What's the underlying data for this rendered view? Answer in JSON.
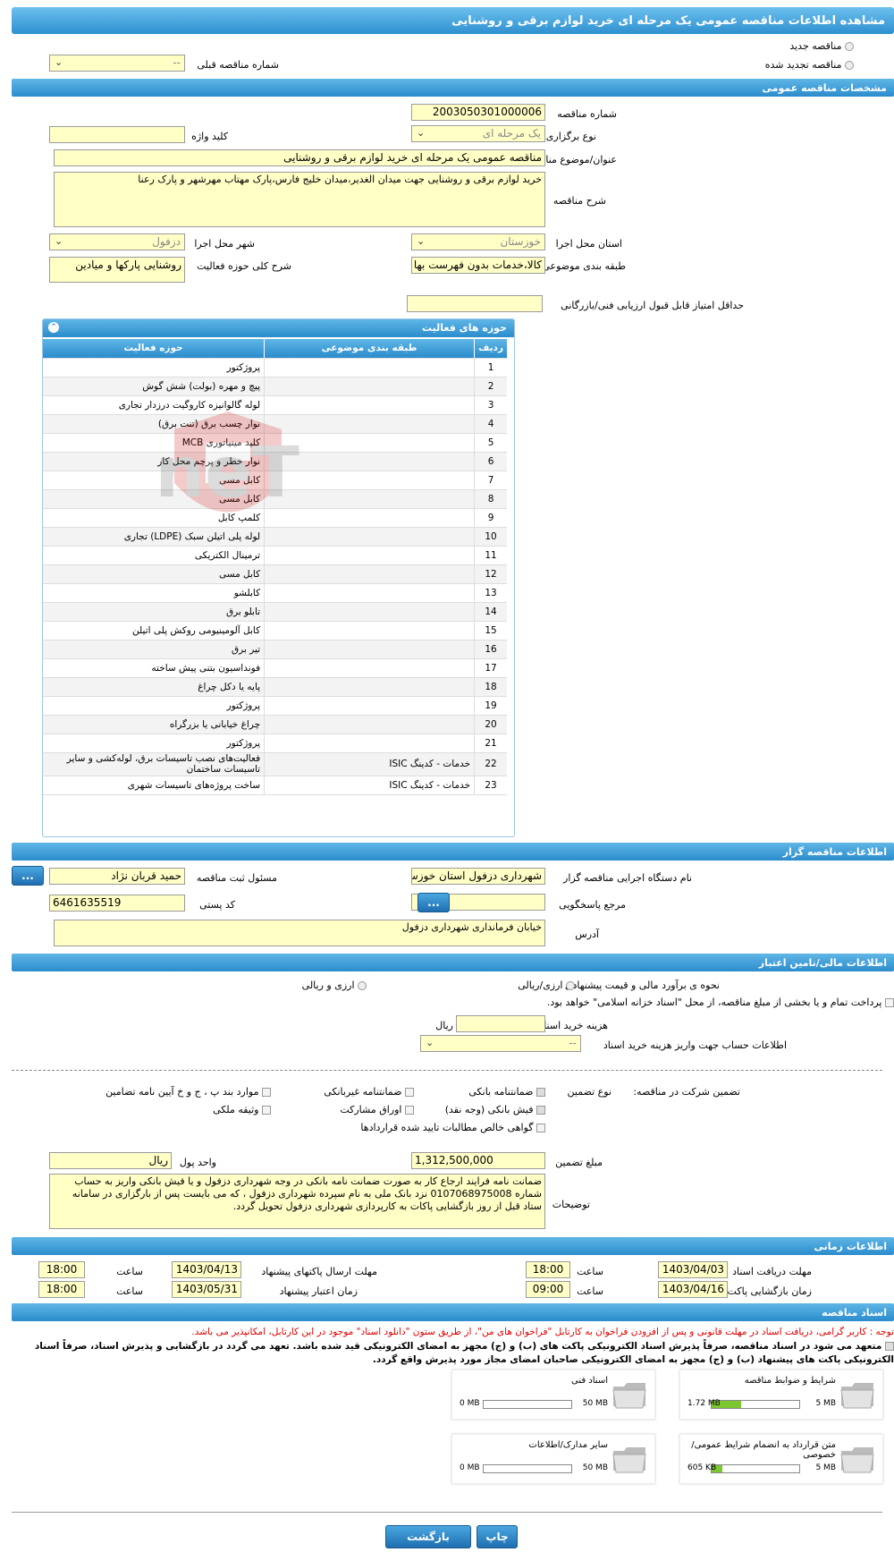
{
  "header": {
    "title": "مشاهده اطلاعات مناقصه عمومی یک مرحله ای خرید لوازم برقی و روشنایی"
  },
  "top": {
    "radio_new": "مناقصه جدید",
    "radio_renew": "مناقصه تجدید شده",
    "prev_label": "شماره مناقصه قبلی",
    "prev_value": "--"
  },
  "general": {
    "title": "مشخصات مناقصه عمومی",
    "number_label": "شماره مناقصه",
    "number": "2003050301000006",
    "type_label": "نوع برگزاری",
    "type": "یک مرحله ای",
    "keyword_label": "کلید واژه",
    "keyword": "",
    "subject_label": "عنوان/موضوع مناقصه",
    "subject": "مناقصه عمومی یک مرحله ای خرید لوازم برقی و روشنایی",
    "desc_label": "شرح مناقصه",
    "desc": "خرید لوازم برقی و روشنایی جهت میدان الغدیر،میدان خلیج فارس،پارک مهتاب مهرشهر و پارک رعنا",
    "province_label": "استان محل اجرا",
    "province": "خوزستان",
    "city_label": "شهر محل اجرا",
    "city": "دزفول",
    "category_label": "طبقه بندی موضوعی",
    "category": "کالا،خدمات بدون فهرست بها",
    "scope_label": "شرح کلی حوزه فعالیت",
    "scope": "روشنایی پارکها و میادین",
    "min_score_label": "حداقل امتیاز قابل قبول ارزیابی فنی/بازرگانی",
    "min_score": ""
  },
  "activities": {
    "title": "حوزه های فعالیت",
    "col_row": "ردیف",
    "col_class": "طبقه بندی موضوعی",
    "col_area": "حوزه فعالیت",
    "rows": [
      {
        "n": "1",
        "c": "",
        "a": "پروژکتور"
      },
      {
        "n": "2",
        "c": "",
        "a": "پیچ و مهره (بولت) شش گوش"
      },
      {
        "n": "3",
        "c": "",
        "a": "لوله گالوانیزه کاروگیت درزدار تجاری"
      },
      {
        "n": "4",
        "c": "",
        "a": "نوار چسب برق (تنت برق)"
      },
      {
        "n": "5",
        "c": "",
        "a": "کلید مینیاتوری MCB"
      },
      {
        "n": "6",
        "c": "",
        "a": "نوار خطر و پرچم محل کار"
      },
      {
        "n": "7",
        "c": "",
        "a": "کابل مسی"
      },
      {
        "n": "8",
        "c": "",
        "a": "کابل مسی"
      },
      {
        "n": "9",
        "c": "",
        "a": "کلمپ کابل"
      },
      {
        "n": "10",
        "c": "",
        "a": "لوله پلی اتیلن سبک (LDPE) تجاری"
      },
      {
        "n": "11",
        "c": "",
        "a": "ترمینال الکتریکی"
      },
      {
        "n": "12",
        "c": "",
        "a": "کابل مسی"
      },
      {
        "n": "13",
        "c": "",
        "a": "کابلشو"
      },
      {
        "n": "14",
        "c": "",
        "a": "تابلو برق"
      },
      {
        "n": "15",
        "c": "",
        "a": "کابل آلومینیومی روکش پلی اتیلن"
      },
      {
        "n": "16",
        "c": "",
        "a": "تیر برق"
      },
      {
        "n": "17",
        "c": "",
        "a": "فونداسیون بتنی پیش ساخته"
      },
      {
        "n": "18",
        "c": "",
        "a": "پایه یا دکل چراغ"
      },
      {
        "n": "19",
        "c": "",
        "a": "پروژکتور"
      },
      {
        "n": "20",
        "c": "",
        "a": "چراغ خیابانی یا بزرگراه"
      },
      {
        "n": "21",
        "c": "",
        "a": "پروژکتور"
      },
      {
        "n": "22",
        "c": "خدمات - کدینگ ISIC",
        "a": "فعالیت‌های نصب تاسیسات برق، لوله‌کشی و سایر تاسیسات ساختمان"
      },
      {
        "n": "23",
        "c": "خدمات - کدینگ ISIC",
        "a": "ساخت پروژه‌های تاسیسات شهری"
      }
    ]
  },
  "org": {
    "title": "اطلاعات مناقصه گزار",
    "exec_label": "نام دستگاه اجرایی مناقصه گزار",
    "exec": "شهرداری دزفول استان خوزستان",
    "resp_label": "مسئول ثبت مناقصه",
    "resp": "حمید قربان نژاد",
    "ref_label": "مرجع پاسخگویی",
    "ref": "",
    "postal_label": "کد پستی",
    "postal": "6461635519",
    "address_label": "آدرس",
    "address": "خیابان فرمانداری شهرداری دزفول",
    "more": "..."
  },
  "finance": {
    "title": "اطلاعات مالی/تامین اعتبار",
    "estimate_label": "نحوه ی برآورد مالی و قیمت پیشنهادی",
    "opt1": "ارزی/ریالی",
    "opt2": "ارزی و ریالی",
    "treasury": "پرداخت تمام و یا بخشی از مبلغ مناقصه، از محل \"اسناد خزانه اسلامی\" خواهد بود.",
    "doc_cost_label": "هزینه خرید اسناد",
    "doc_cost_unit": "ریال",
    "doc_cost": "",
    "account_label": "اطلاعات حساب جهت واریز هزینه خرید اسناد",
    "account": "--"
  },
  "guarantee": {
    "section_label": "تضمین شرکت در مناقصه:",
    "type_label": "نوع تضمین",
    "bank": "ضمانتنامه بانکی",
    "nonbank": "ضمانتنامه غیربانکی",
    "rules": "موارد بند پ ، ج و خ آیین نامه تضامین",
    "cash": "فیش بانکی (وجه نقد)",
    "bonds": "اوراق مشارکت",
    "property": "وثیقه ملکی",
    "claims": "گواهی خالص مطالبات تایید شده قراردادها",
    "amount_label": "مبلغ تضمین",
    "amount": "1,312,500,000",
    "unit_label": "واحد پول",
    "unit": "ریال",
    "notes_label": "توضیحات",
    "notes": "ضمانت نامه فرایند ارجاع کار به صورت ضمانت نامه بانکی در وجه شهرداری دزفول و یا فیش بانکی واریز به حساب شماره 0107068975008 نزد بانک ملی به نام سپرده شهرداری دزفول ، که می بایست پس از بارگزاری در سامانه ستاد قبل از روز بازگشایی پاکات به کارپردازی شهرداری دزفول تحویل گردد."
  },
  "timing": {
    "title": "اطلاعات زمانی",
    "get_docs_label": "مهلت دریافت اسناد",
    "get_docs_date": "1403/04/03",
    "get_docs_time": "18:00",
    "send_label": "مهلت ارسال پاکتهای پیشنهاد",
    "send_date": "1403/04/13",
    "send_time": "18:00",
    "open_label": "زمان بازگشایی پاکت ها",
    "open_date": "1403/04/16",
    "open_time": "09:00",
    "valid_label": "زمان اعتبار پیشنهاد",
    "valid_date": "1403/05/31",
    "valid_time": "18:00",
    "time_label": "ساعت"
  },
  "docs": {
    "title": "اسناد مناقصه",
    "note": "توجه : کاربر گرامی، دریافت اسناد در مهلت قانونی و پس از افزودن فراخوان به کارتابل \"فراخوان های من\"، از طریق ستون \"دانلود اسناد\" موجود در این کارتابل، امکانپذیر می باشد.",
    "commit": "متعهد می شود در اسناد مناقصه، صرفاً پذیرش اسناد الکترونیکی پاکت های (ب) و (ج) مجهز به امضای الکترونیکی قید شده باشد. تعهد می گردد در بازگشایی و پذیرش اسناد، صرفاً اسناد الکترونیکی پاکت های پیشنهاد (ب) و (ج) مجهز به امضای الکترونیکی صاحبان امضای مجاز مورد پذیرش واقع گردد.",
    "items": [
      {
        "name": "شرایط و ضوابط مناقصه",
        "used": "1.72 MB",
        "max": "5 MB",
        "fraction": 0.34
      },
      {
        "name": "اسناد فنی",
        "used": "0 MB",
        "max": "50 MB",
        "fraction": 0
      },
      {
        "name": "متن قرارداد به انضمام شرایط عمومی/خصوصی",
        "used": "605 KB",
        "max": "5 MB",
        "fraction": 0.12
      },
      {
        "name": "سایر مدارک/اطلاعات",
        "used": "0 MB",
        "max": "50 MB",
        "fraction": 0
      }
    ]
  },
  "footer": {
    "print": "چاپ",
    "back": "بازگشت"
  },
  "watermark": "AriaTender.neT"
}
